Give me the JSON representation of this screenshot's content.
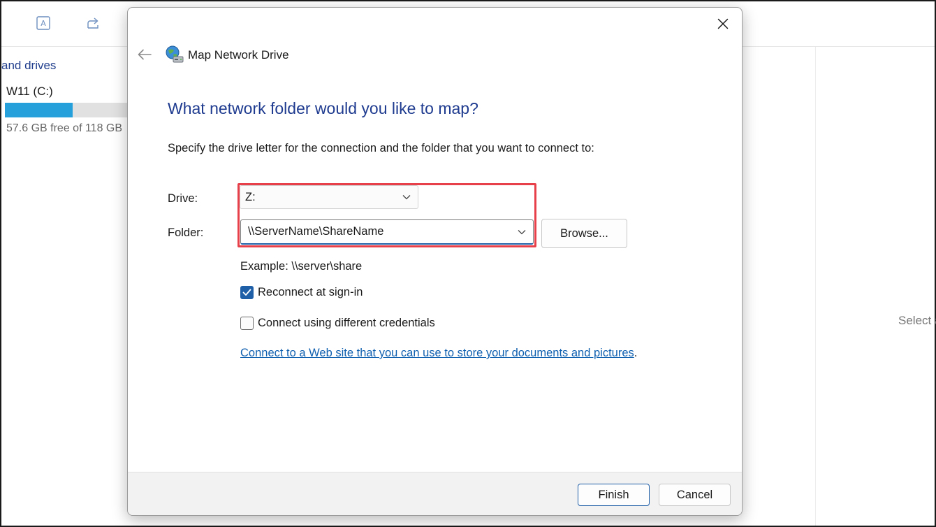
{
  "background": {
    "section_label": "and drives",
    "drive_name": "W11 (C:)",
    "drive_free_text": "57.6 GB free of 118 GB",
    "drive_used_fraction": 0.51,
    "details_hint": "Select a"
  },
  "dialog": {
    "title": "Map Network Drive",
    "heading": "What network folder would you like to map?",
    "instruction": "Specify the drive letter for the connection and the folder that you want to connect to:",
    "drive_label": "Drive:",
    "drive_value": "Z:",
    "folder_label": "Folder:",
    "folder_value": "\\\\ServerName\\ShareName",
    "browse_label": "Browse...",
    "example_text": "Example: \\\\server\\share",
    "reconnect_label": "Reconnect at sign-in",
    "reconnect_checked": true,
    "credentials_label": "Connect using different credentials",
    "credentials_checked": false,
    "web_link": "Connect to a Web site that you can use to store your documents and pictures",
    "web_link_suffix": ".",
    "finish_label": "Finish",
    "cancel_label": "Cancel"
  },
  "colors": {
    "heading": "#1e3b8f",
    "accent": "#1f5fa8",
    "highlight": "#e8404a",
    "link": "#1060b0",
    "drive_bar": "#26a0da"
  },
  "icons": {
    "toolbar_1": "translate-icon",
    "toolbar_2": "share-icon",
    "back": "back-arrow-icon",
    "wizard": "network-drive-icon",
    "close": "close-icon"
  }
}
